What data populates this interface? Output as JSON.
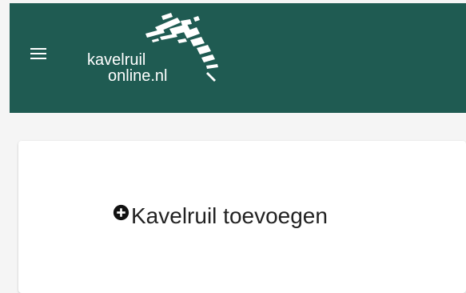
{
  "header": {
    "menu_icon": "hamburger-menu-icon",
    "background_color": "#1f5b52",
    "logo": {
      "line1": "kavelruil",
      "line2": "online.nl"
    }
  },
  "card": {
    "action_icon": "plus-circle-icon",
    "action_label": "Kavelruil toevoegen"
  }
}
